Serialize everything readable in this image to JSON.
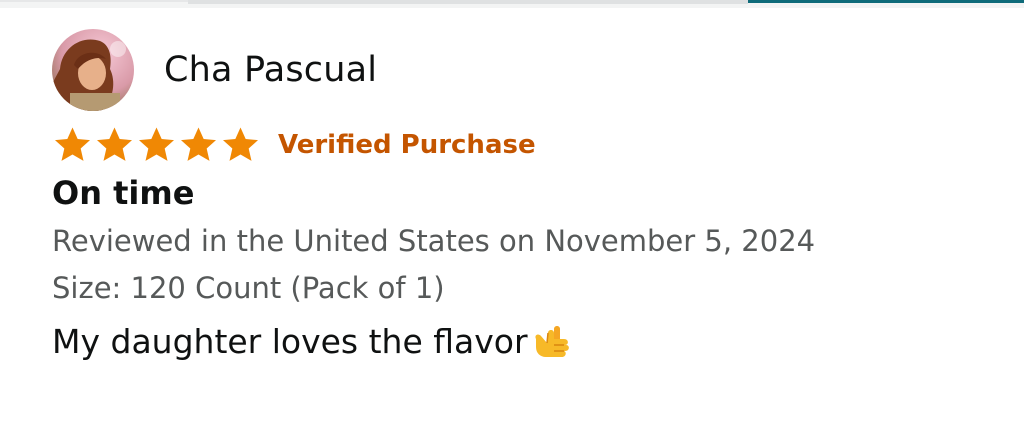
{
  "review": {
    "reviewer_name": "Cha Pascual",
    "avatar_icon": "profile-photo",
    "rating": 5,
    "rating_max": 5,
    "star_color": "#f08804",
    "verified_label": "Verified Purchase",
    "verified_color": "#c45500",
    "title": "On time",
    "date_text": "Reviewed in the United States on November 5, 2024",
    "size_text": "Size: 120 Count (Pack of 1)",
    "body_text": "My daughter loves the flavor",
    "body_emoji_icon": "call-me-hand-icon"
  }
}
